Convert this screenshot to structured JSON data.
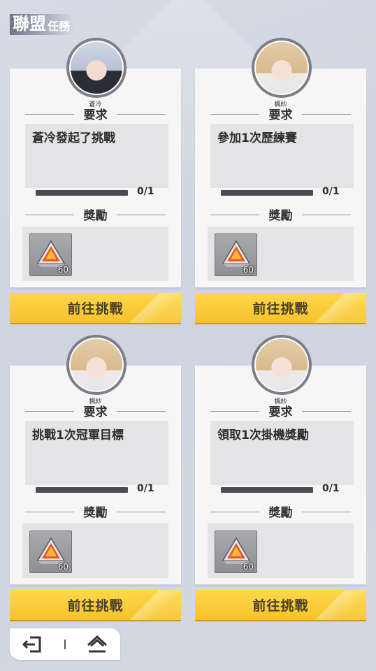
{
  "header": {
    "title": "聯盟",
    "subtitle": "任務"
  },
  "cards": [
    {
      "npc_name": "蒼冷",
      "requirement_title": "要求",
      "requirement_text": "蒼冷發起了挑戰",
      "progress_text": "0/1",
      "progress_value": 0,
      "reward_title": "獎勵",
      "reward_item": {
        "icon": "fire-crystal-icon",
        "count": "60"
      },
      "button_label": "前往挑戰"
    },
    {
      "npc_name": "楓紗",
      "requirement_title": "要求",
      "requirement_text": "參加1次歷練賽",
      "progress_text": "0/1",
      "progress_value": 0,
      "reward_title": "獎勵",
      "reward_item": {
        "icon": "fire-crystal-icon",
        "count": "60"
      },
      "button_label": "前往挑戰"
    },
    {
      "npc_name": "楓紗",
      "requirement_title": "要求",
      "requirement_text": "挑戰1次冠軍目標",
      "progress_text": "0/1",
      "progress_value": 0,
      "reward_title": "獎勵",
      "reward_item": {
        "icon": "fire-crystal-icon",
        "count": "60"
      },
      "button_label": "前往挑戰"
    },
    {
      "npc_name": "楓紗",
      "requirement_title": "要求",
      "requirement_text": "領取1次掛機獎勵",
      "progress_text": "0/1",
      "progress_value": 0,
      "reward_title": "獎勵",
      "reward_item": {
        "icon": "fire-crystal-icon",
        "count": "60"
      },
      "button_label": "前往挑戰"
    }
  ],
  "bottom_bar": {
    "back_icon": "exit-icon",
    "home_icon": "home-icon"
  },
  "colors": {
    "accent": "#f6c22b",
    "card_bg": "#f6f6f7",
    "progress_track": "#4a4c52"
  }
}
